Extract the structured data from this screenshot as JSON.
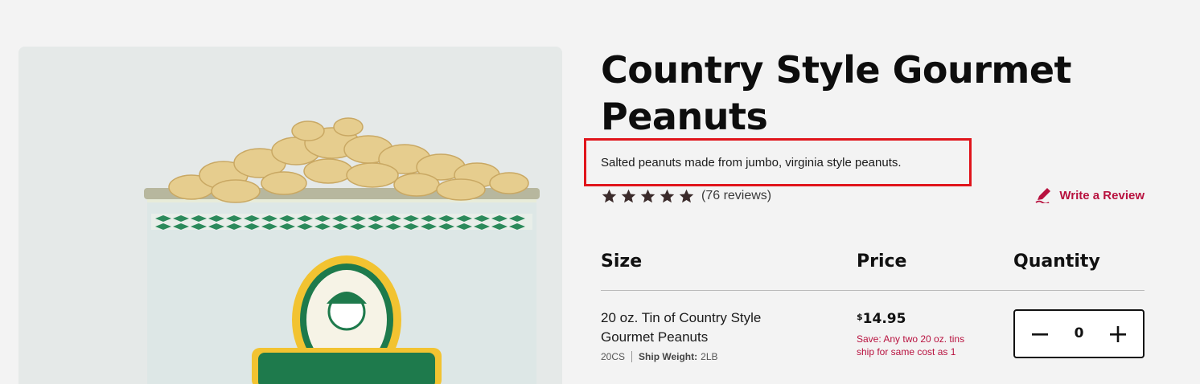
{
  "product": {
    "title": "Country Style Gourmet Peanuts",
    "description": "Salted peanuts made from jumbo, virginia style peanuts.",
    "image": {
      "alt": "Tin of Country Style Gourmet Peanuts"
    }
  },
  "rating": {
    "stars": 5,
    "count_text": "(76 reviews)",
    "star_color": "#3b2b2b"
  },
  "write_review": {
    "label": "Write a Review",
    "icon": "pen-icon",
    "color": "#b8123f"
  },
  "table": {
    "headers": {
      "size": "Size",
      "price": "Price",
      "quantity": "Quantity"
    },
    "rows": [
      {
        "size_name": "20 oz. Tin of Country Style Gourmet Peanuts",
        "sku": "20CS",
        "ship_weight_label": "Ship Weight:",
        "ship_weight": "2LB",
        "price_currency": "$",
        "price_amount": "14.95",
        "save_note": "Save: Any two 20 oz. tins ship for same cost as 1",
        "quantity": "0"
      }
    ]
  },
  "colors": {
    "accent": "#b8123f",
    "highlight_box": "#e0141b",
    "background": "#f3f3f3"
  }
}
